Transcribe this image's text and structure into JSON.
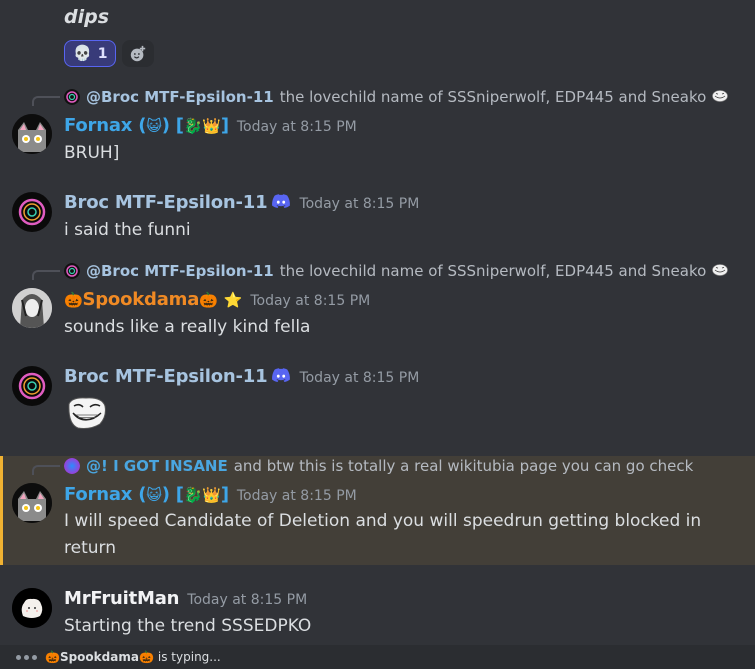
{
  "prev_message": {
    "content": "dips",
    "reactions": [
      {
        "emoji": "💀",
        "icon": "skull-icon",
        "count": "1",
        "active": true
      }
    ],
    "add_reaction_icon": "add-reaction-icon"
  },
  "messages": [
    {
      "reply": {
        "avatar_icon": "scp-logo-avatar",
        "author": "@Broc MTF-Epsilon-11",
        "text": "the lovechild name of SSSniperwolf, EDP445 and Sneako",
        "trailing_emoji": "🤡",
        "trailing_emoji_name": "trollface-emoji"
      },
      "author": "Fornax (",
      "author_emoji1": "😺",
      "author_mid": ") [",
      "author_emoji2": "🐉👑",
      "author_end": "]",
      "timestamp": "Today at 8:15 PM",
      "content": "BRUH]"
    },
    {
      "author": "Broc MTF-Epsilon-11",
      "badge": "discord-icon",
      "timestamp": "Today at 8:15 PM",
      "content": "i said the funni"
    },
    {
      "reply": {
        "avatar_icon": "scp-logo-avatar",
        "author": "@Broc MTF-Epsilon-11",
        "text": "the lovechild name of SSSniperwolf, EDP445 and Sneako",
        "trailing_emoji": "🤡",
        "trailing_emoji_name": "trollface-emoji"
      },
      "author_prefix_emoji": "🎃",
      "author": "Spookdama",
      "author_suffix_emoji": "🎃",
      "badge_emoji": "⭐",
      "timestamp": "Today at 8:15 PM",
      "content": "sounds like a really kind fella"
    },
    {
      "author": "Broc MTF-Epsilon-11",
      "badge": "discord-icon",
      "timestamp": "Today at 8:15 PM",
      "content_emoji": "trollface-emoji"
    },
    {
      "highlighted": true,
      "reply": {
        "author": "@! I GOT INSANE",
        "text": "and btw this is totally a real wikitubia page you can go check"
      },
      "author": "Fornax (",
      "author_emoji1": "😺",
      "author_mid": ") [",
      "author_emoji2": "🐉👑",
      "author_end": "]",
      "timestamp": "Today at 8:15 PM",
      "content_line1": "I will speed Candidate of Deletion and you will speedrun getting blocked in",
      "content_line2": "return"
    },
    {
      "author": "MrFruitMan",
      "timestamp": "Today at 8:15 PM",
      "content": "Starting the trend SSSEDPKO"
    }
  ],
  "typing": {
    "prefix_emoji": "🎃",
    "user": "Spookdama",
    "suffix_emoji": "🎃",
    "text": "is typing..."
  },
  "colors": {
    "background": "#313338",
    "highlight_bg": "#433f38",
    "highlight_bar": "#f0b232",
    "fornax": "#3ea6e8",
    "broc": "#a7c4e0",
    "spookdama": "#f08a24",
    "reaction_bg": "#383b79",
    "reaction_border": "#5865f2"
  }
}
